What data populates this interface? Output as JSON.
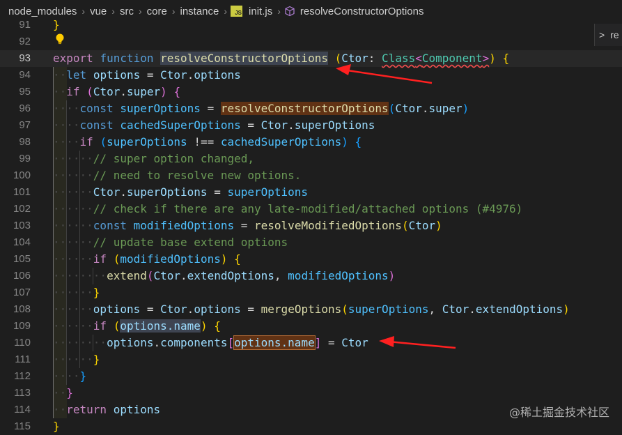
{
  "breadcrumb": {
    "items": [
      "node_modules",
      "vue",
      "src",
      "core",
      "instance"
    ],
    "file_badge": "JS",
    "file": "init.js",
    "symbol": "resolveConstructorOptions",
    "symbol_icon": "cube-icon"
  },
  "side_panel": {
    "chevron": ">",
    "label": "re"
  },
  "line_numbers": [
    "91",
    "92",
    "93",
    "94",
    "95",
    "96",
    "97",
    "98",
    "99",
    "100",
    "101",
    "102",
    "103",
    "104",
    "105",
    "106",
    "107",
    "108",
    "109",
    "110",
    "111",
    "112",
    "113",
    "114",
    "115"
  ],
  "current_line": "93",
  "code": {
    "l91_brace": "}",
    "l93_export": "export",
    "l93_function": "function",
    "l93_name": "resolveConstructorOptions",
    "l93_param": "Ctor",
    "l93_type": "Class",
    "l93_generic": "Component",
    "l94_let": "let",
    "l94_var": "options",
    "l94_obj": "Ctor",
    "l94_prop": "options",
    "l95_if": "if",
    "l95_obj": "Ctor",
    "l95_prop": "super",
    "l96_const": "const",
    "l96_var": "superOptions",
    "l96_fn": "resolveConstructorOptions",
    "l96_obj": "Ctor",
    "l96_prop": "super",
    "l97_const": "const",
    "l97_var": "cachedSuperOptions",
    "l97_obj": "Ctor",
    "l97_prop": "superOptions",
    "l98_if": "if",
    "l98_a": "superOptions",
    "l98_op": "!==",
    "l98_b": "cachedSuperOptions",
    "l99_comment": "// super option changed,",
    "l100_comment": "// need to resolve new options.",
    "l101_obj": "Ctor",
    "l101_prop": "superOptions",
    "l101_val": "superOptions",
    "l102_comment": "// check if there are any late-modified/attached options (#4976)",
    "l103_const": "const",
    "l103_var": "modifiedOptions",
    "l103_fn": "resolveModifiedOptions",
    "l103_arg": "Ctor",
    "l104_comment": "// update base extend options",
    "l105_if": "if",
    "l105_arg": "modifiedOptions",
    "l106_fn": "extend",
    "l106_obj": "Ctor",
    "l106_prop": "extendOptions",
    "l106_arg2": "modifiedOptions",
    "l107_brace": "}",
    "l108_var": "options",
    "l108_obj": "Ctor",
    "l108_prop": "options",
    "l108_fn": "mergeOptions",
    "l108_arg1": "superOptions",
    "l108_arg2obj": "Ctor",
    "l108_arg2prop": "extendOptions",
    "l109_if": "if",
    "l109_cond": "options.name",
    "l110_obj": "options",
    "l110_prop": "components",
    "l110_key": "options.name",
    "l110_val": "Ctor",
    "l111_brace": "}",
    "l112_brace": "}",
    "l113_brace": "}",
    "l114_return": "return",
    "l114_var": "options",
    "l115_brace": "}"
  },
  "watermark": "@稀土掘金技术社区",
  "colors": {
    "background": "#1e1e1e",
    "keyword": "#569cd6",
    "control": "#c586c0",
    "function": "#dcdcaa",
    "variable": "#9cdcfe",
    "constant": "#4fc1ff",
    "type": "#4ec9b0",
    "comment": "#6a9955",
    "annotation_arrow": "#ff2020"
  }
}
